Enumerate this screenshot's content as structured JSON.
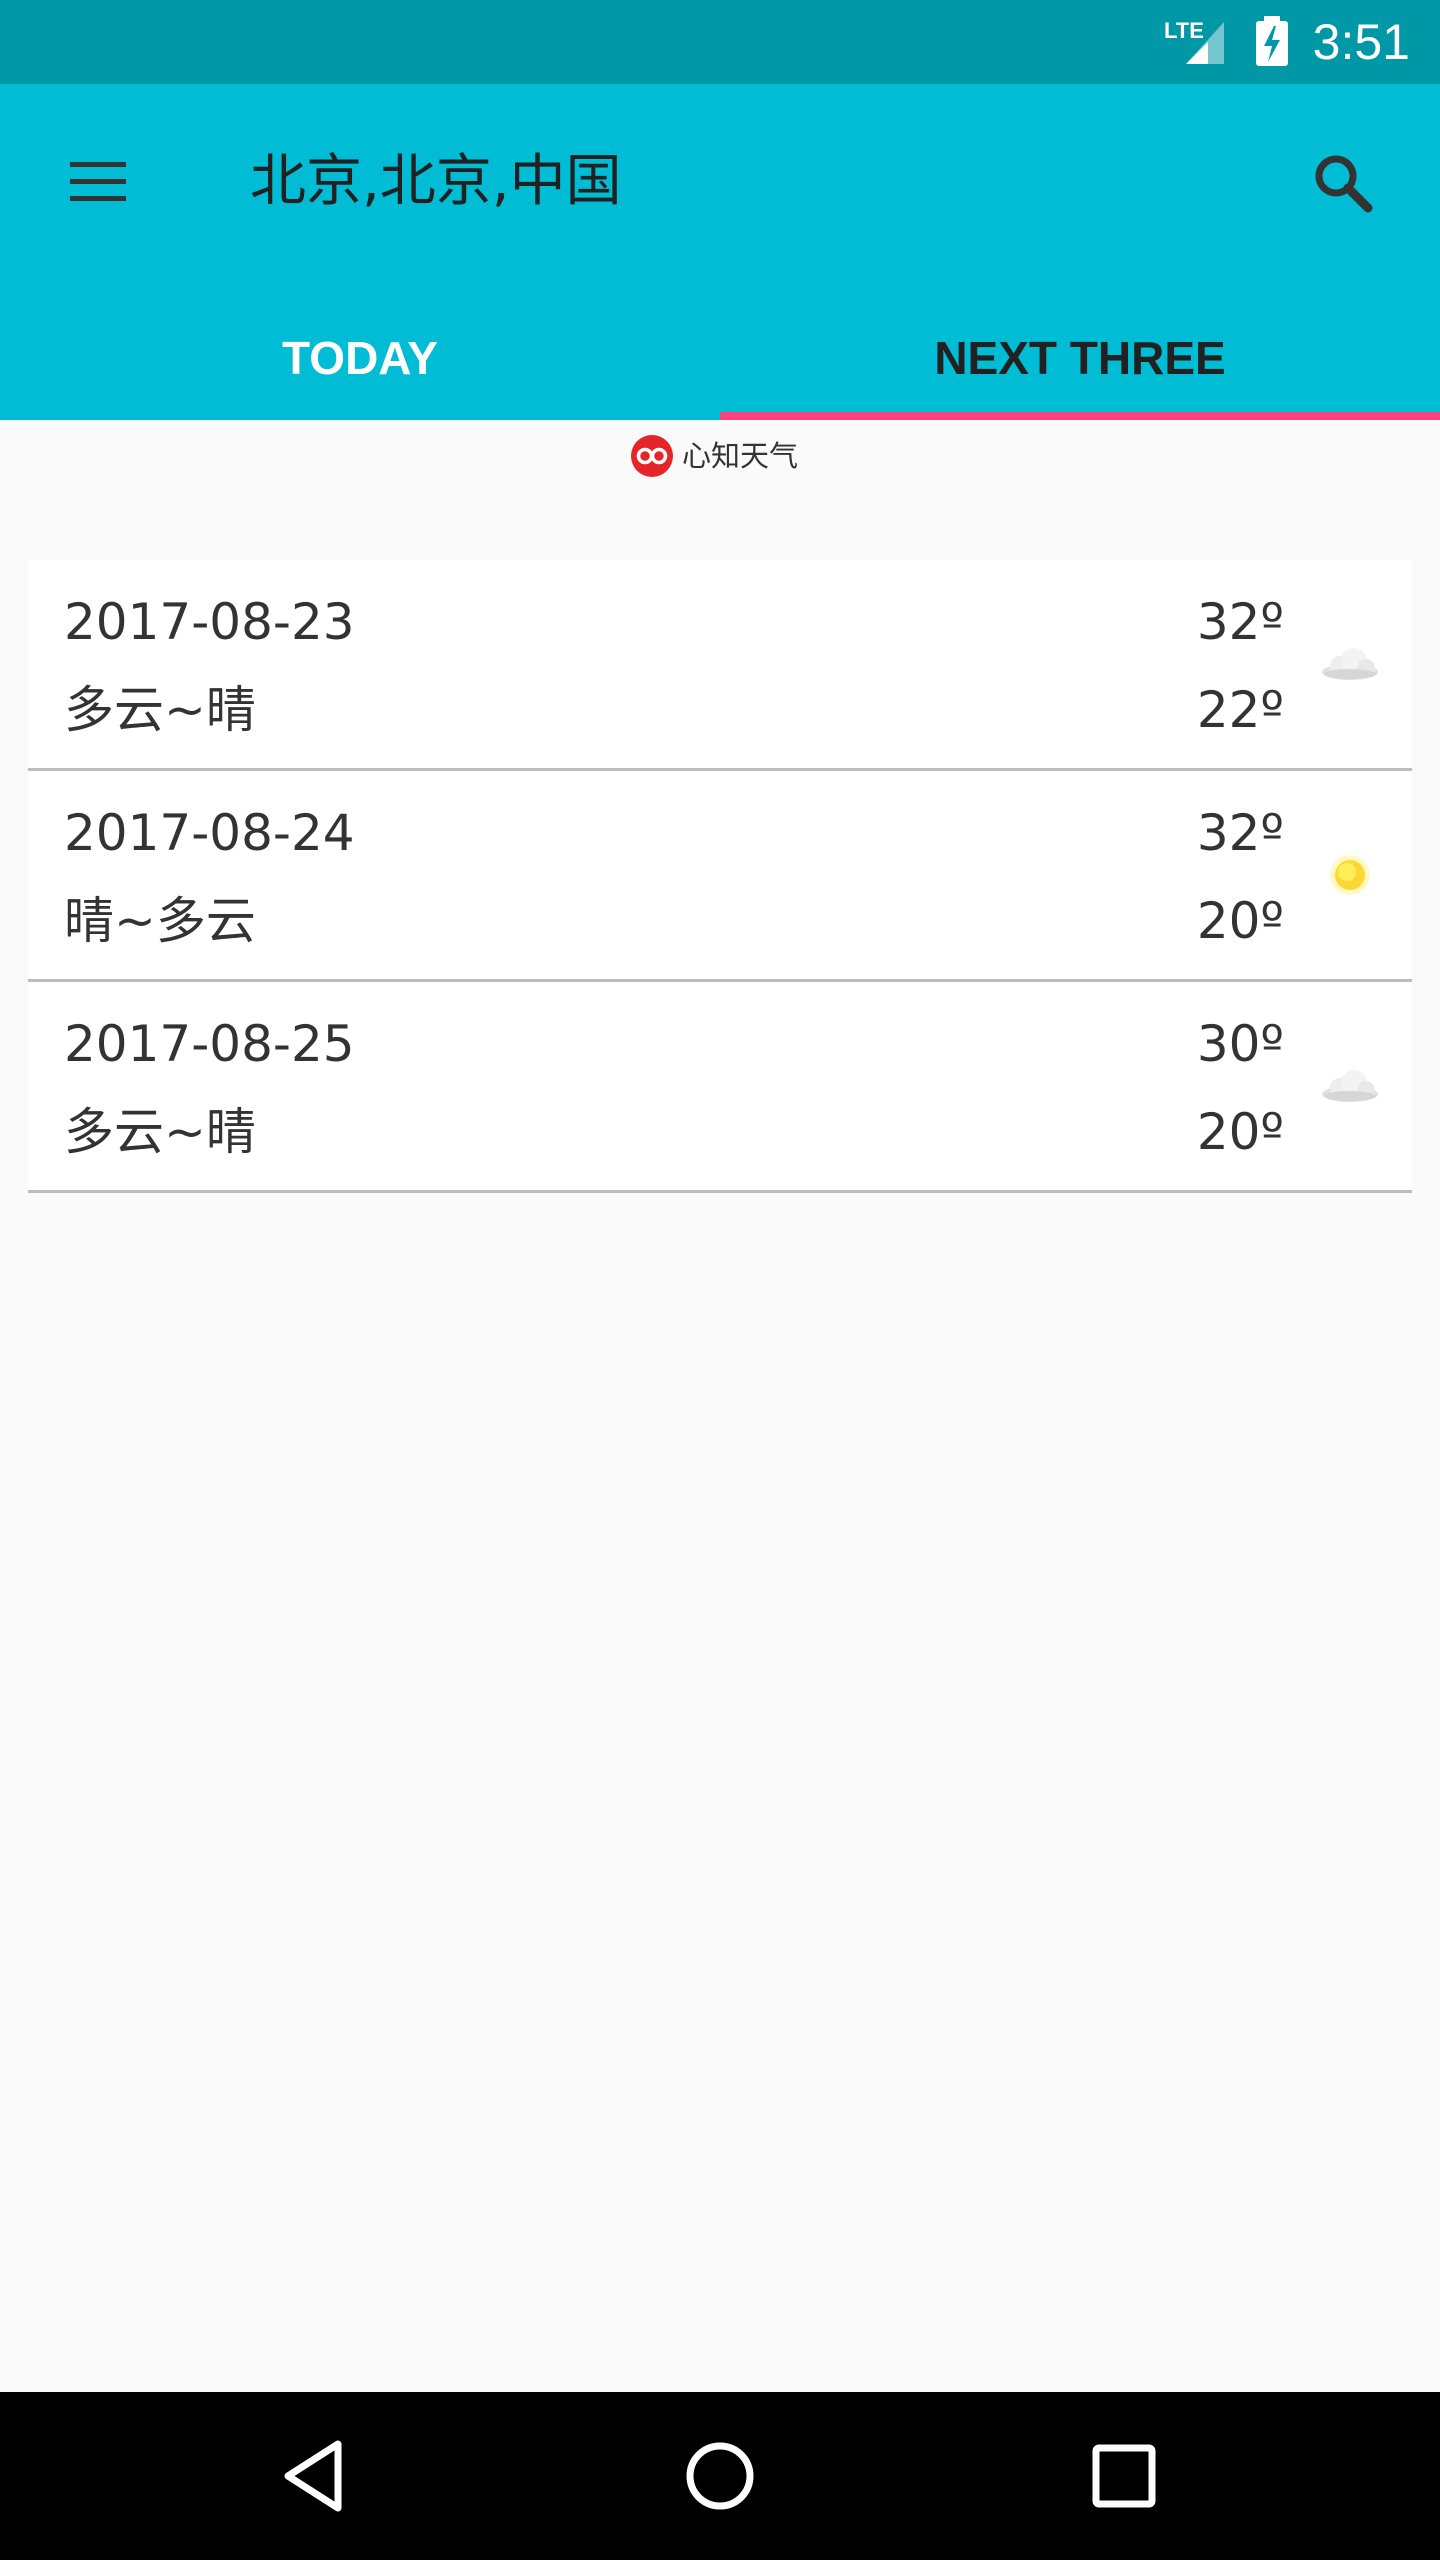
{
  "status_bar": {
    "network_label": "LTE",
    "time": "3:51",
    "network_icon": "signal-lte-icon",
    "battery_icon": "battery-charging-icon"
  },
  "app_bar": {
    "title": "北京,北京,中国",
    "menu_icon": "menu-icon",
    "search_icon": "search-icon",
    "background_color": "#00bcd4",
    "status_color": "#0097a7"
  },
  "tabs": [
    {
      "label": "TODAY",
      "selected": false
    },
    {
      "label": "NEXT THREE",
      "selected": true
    }
  ],
  "tab_indicator_color": "#ff4081",
  "provider": {
    "name": "心知天气",
    "logo_icon": "seniverse-logo-icon",
    "logo_color": "#e5252a"
  },
  "forecast": [
    {
      "date": "2017-08-23",
      "description": "多云~晴",
      "high": "32º",
      "low": "22º",
      "icon": "cloud-icon"
    },
    {
      "date": "2017-08-24",
      "description": "晴~多云",
      "high": "32º",
      "low": "20º",
      "icon": "sun-icon"
    },
    {
      "date": "2017-08-25",
      "description": "多云~晴",
      "high": "30º",
      "low": "20º",
      "icon": "cloud-icon"
    }
  ],
  "nav_bar": {
    "back_icon": "back-triangle-icon",
    "home_icon": "home-circle-icon",
    "recents_icon": "recents-square-icon"
  }
}
